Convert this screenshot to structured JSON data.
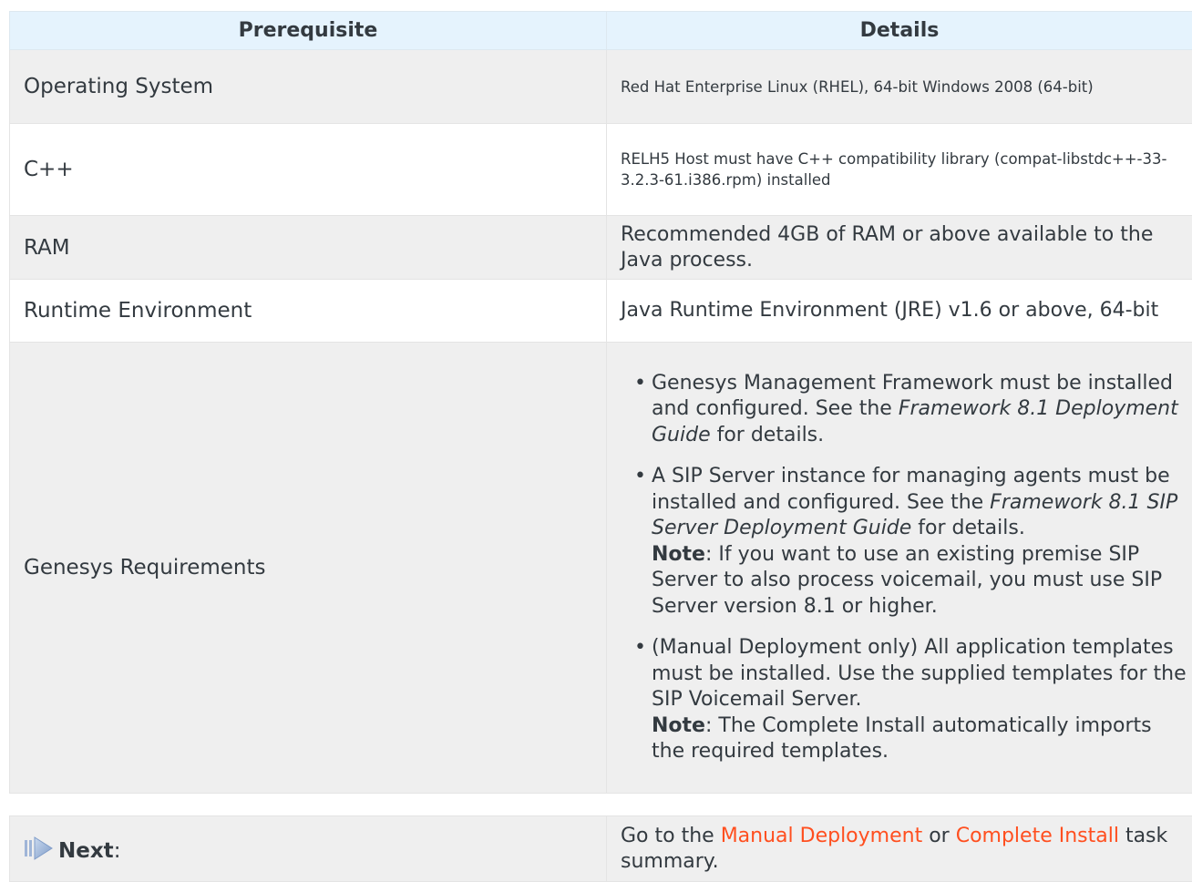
{
  "table": {
    "headers": [
      "Prerequisite",
      "Details"
    ],
    "rows": [
      {
        "prerequisite": "Operating System",
        "details": "Red Hat Enterprise Linux (RHEL), 64-bit Windows 2008 (64-bit)"
      },
      {
        "prerequisite": "C++",
        "details": "RELH5 Host must have C++ compatibility library (compat-libstdc++-33-3.2.3-61.i386.rpm) installed"
      },
      {
        "prerequisite": "RAM",
        "details": "Recommended 4GB of RAM or above available to the Java process."
      },
      {
        "prerequisite": "Runtime Environment",
        "details": "Java Runtime Environment (JRE) v1.6 or above, 64-bit"
      },
      {
        "prerequisite": "Genesys Requirements",
        "bullets": [
          {
            "text1": "Genesys Management Framework must be installed and configured. See the ",
            "italic": "Framework 8.1 Deployment Guide",
            "text2": " for details."
          },
          {
            "text1": "A SIP Server instance for managing agents must be installed and configured. See the ",
            "italic": "Framework 8.1 SIP Server Deployment Guide",
            "text2": " for details.",
            "note_label": "Note",
            "note_text": ": If you want to use an existing premise SIP Server to also process voicemail, you must use SIP Server version 8.1 or higher."
          },
          {
            "text1": "(Manual Deployment only) All application templates must be installed. Use the supplied templates for the SIP Voicemail Server.",
            "note_label": "Note",
            "note_text": ": The Complete Install automatically imports the required templates."
          }
        ]
      }
    ]
  },
  "next": {
    "label": "Next",
    "colon": ":",
    "text_before": "Go to the ",
    "link1": "Manual Deployment",
    "text_mid": " or ",
    "link2": "Complete Install",
    "text_after": " task summary.",
    "icon": "next-arrow-icon",
    "link_color": "#ff4f1f"
  }
}
